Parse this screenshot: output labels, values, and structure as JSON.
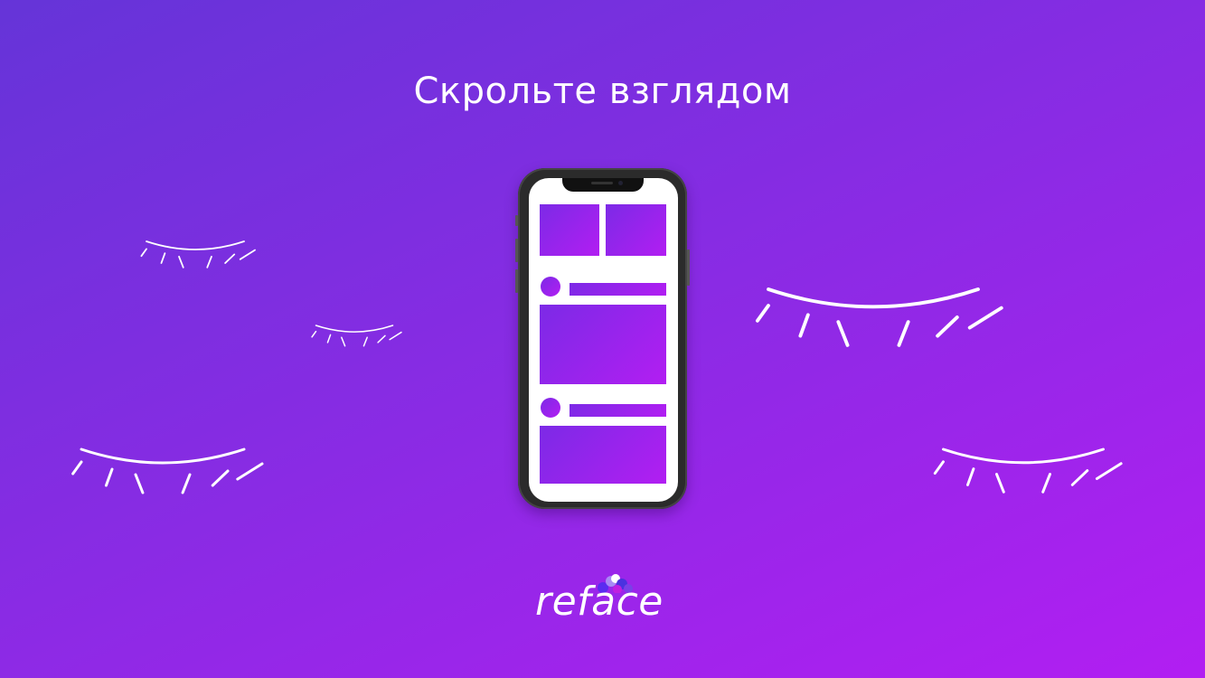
{
  "title": "Скрольте взглядом",
  "brand": {
    "logo_text": "reface"
  },
  "colors": {
    "background_start": "#6534d8",
    "background_end": "#b21ef2",
    "foreground": "#ffffff"
  },
  "icons": [
    "closed-eye-icon",
    "phone-illustration",
    "reface-logo"
  ]
}
